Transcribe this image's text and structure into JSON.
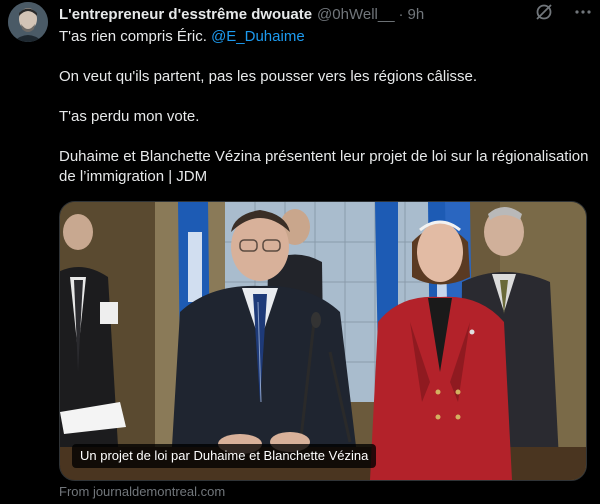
{
  "post": {
    "display_name": "L'entrepreneur d'esstrême dwouate",
    "handle": "@0hWell__",
    "separator": "·",
    "time": "9h",
    "line1_prefix": "T'as rien compris Éric. ",
    "mention": "@E_Duhaime",
    "para2": "On veut qu'ils partent, pas les pousser vers les régions câlisse.",
    "para3": "T'as perdu mon vote.",
    "para4": "Duhaime et Blanchette Vézina présentent leur projet de loi sur la régionalisation de l’immigration | JDM"
  },
  "icons": {
    "grok": "grok-slash-icon",
    "more": "more-dots-icon"
  },
  "card": {
    "caption": "Un projet de loi par Duhaime et Blanchette Vézina",
    "source": "From journaldemontreal.com"
  },
  "colors": {
    "background": "#000000",
    "text": "#e7e9ea",
    "muted": "#71767b",
    "link": "#1d9bf0"
  }
}
